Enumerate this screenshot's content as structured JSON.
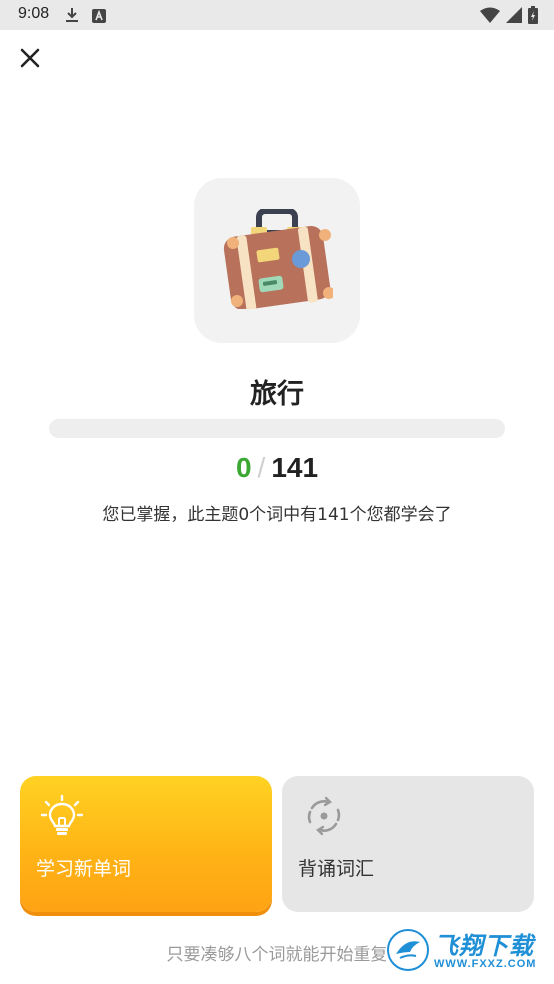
{
  "status_bar": {
    "time": "9:08",
    "icons": [
      "download-icon",
      "keyboard-a-icon",
      "wifi-icon",
      "signal-icon",
      "battery-charging-icon"
    ]
  },
  "topic": {
    "title": "旅行",
    "icon": "suitcase-icon",
    "learned": "0",
    "separator": "/",
    "total": "141",
    "progress_fraction": 0,
    "description": "您已掌握，此主题0个词中有141个您都学会了"
  },
  "actions": {
    "learn_label": "学习新单词",
    "learn_icon": "lightbulb-icon",
    "review_label": "背诵词汇",
    "review_icon": "refresh-cycle-icon"
  },
  "hint": "只要凑够八个词就能开始重复",
  "watermark": {
    "brand": "飞翔下载",
    "url": "WWW.FXXZ.COM"
  },
  "colors": {
    "accent_green": "#3aa832",
    "learn_card": "#ffb215",
    "review_card": "#e6e6e6"
  }
}
